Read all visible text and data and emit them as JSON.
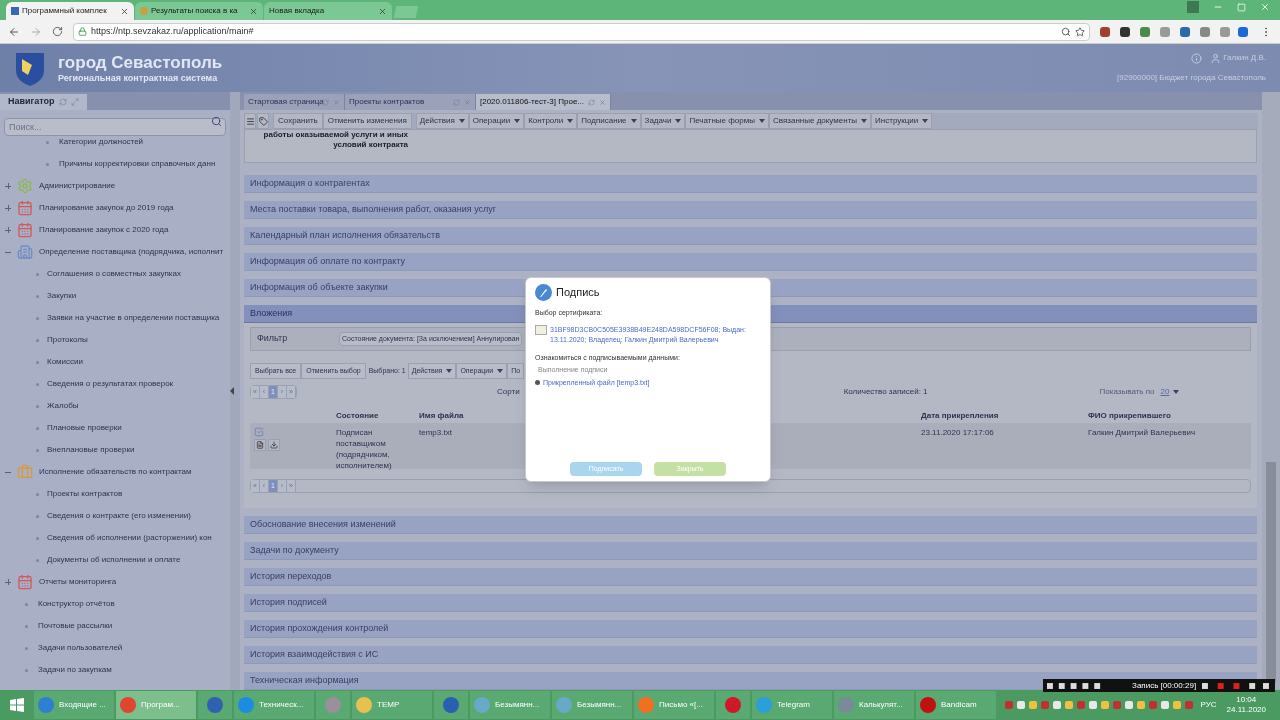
{
  "browser": {
    "tabs": [
      {
        "title": "Программный комплек",
        "selected": true
      },
      {
        "title": "Результаты поиска в ка",
        "selected": false
      },
      {
        "title": "Новая вкладка",
        "selected": false
      }
    ],
    "url": "https://ntp.sevzakaz.ru/application/main#"
  },
  "header": {
    "title": "город Севастополь",
    "subtitle": "Региональная контрактная система",
    "user": "Галкин Д.В.",
    "organization": "[92900000] Бюджет города Севастополь"
  },
  "navigator": {
    "title": "Навигатор",
    "search_placeholder": "Поиск...",
    "items": [
      {
        "kind": "continued",
        "children": [
          {
            "label": "Категории должностей"
          },
          {
            "label": "Причины корректировки справочных данн"
          }
        ]
      },
      {
        "label": "Администрирование",
        "kind": "gear",
        "expanded": false
      },
      {
        "label": "Планирование закупок до 2019 года",
        "kind": "calendar",
        "expanded": false
      },
      {
        "label": "Планирование закупок с 2020 года",
        "kind": "calendar",
        "expanded": false
      },
      {
        "label": "Определение поставщика (подрядчика, исполнит",
        "kind": "building",
        "expanded": true,
        "children": [
          {
            "label": "Соглашения о совместных закупках"
          },
          {
            "label": "Закупки"
          },
          {
            "label": "Заявки на участие в определении поставщика"
          },
          {
            "label": "Протоколы"
          },
          {
            "label": "Комиссии"
          },
          {
            "label": "Сведения о результатах проверок"
          },
          {
            "label": "Жалобы"
          },
          {
            "label": "Плановые проверки"
          },
          {
            "label": "Внеплановые проверки"
          }
        ]
      },
      {
        "label": "Исполнение обязательств по контрактам",
        "kind": "briefcase",
        "expanded": true,
        "children": [
          {
            "label": "Проекты контрактов"
          },
          {
            "label": "Сведения о контракте (его изменении)"
          },
          {
            "label": "Сведения об исполнении (расторжении) кон"
          },
          {
            "label": "Документы об исполнении и оплате"
          }
        ]
      },
      {
        "label": "Отчеты мониторинга",
        "kind": "calendar",
        "expanded": false
      },
      {
        "label": "Конструктор отчётов",
        "kind": "leaf"
      },
      {
        "label": "Почтовые рассылки",
        "kind": "leaf"
      },
      {
        "label": "Задачи пользователей",
        "kind": "leaf"
      },
      {
        "label": "Задачи по закупкам",
        "kind": "leaf"
      }
    ]
  },
  "content_tabs": [
    {
      "label": "Стартовая страница",
      "selected": false
    },
    {
      "label": "Проекты контрактов",
      "selected": false
    },
    {
      "label": "[2020.011806-тест-3] Прое...",
      "selected": true
    }
  ],
  "toolbar": [
    {
      "kind": "menu"
    },
    {
      "kind": "tag"
    },
    {
      "kind": "button",
      "label": "Сохранить"
    },
    {
      "kind": "button",
      "label": "Отменить изменения"
    },
    {
      "kind": "dropdown",
      "label": "Действия"
    },
    {
      "kind": "dropdown",
      "label": "Операции"
    },
    {
      "kind": "dropdown",
      "label": "Контроли"
    },
    {
      "kind": "dropdown",
      "label": "Подписание"
    },
    {
      "kind": "dropdown",
      "label": "Задачи"
    },
    {
      "kind": "dropdown",
      "label": "Печатные формы"
    },
    {
      "kind": "dropdown",
      "label": "Связанные документы"
    },
    {
      "kind": "dropdown",
      "label": "Инструкции"
    }
  ],
  "panel_text": [
    "работы оказываемой услуги и иных",
    "условий контракта"
  ],
  "sections": [
    {
      "title": "Информация о контрагентах",
      "expanded": false
    },
    {
      "title": "Места поставки товара, выполнения работ, оказания услуг",
      "expanded": false
    },
    {
      "title": "Календарный план исполнения обязательств",
      "expanded": false
    },
    {
      "title": "Информация об оплате по контракту",
      "expanded": false
    },
    {
      "title": "Информация об объекте закупки",
      "expanded": false
    },
    {
      "title": "Вложения",
      "expanded": true
    },
    {
      "title": "Обоснование внесения изменений",
      "expanded": false
    },
    {
      "title": "Задачи по документу",
      "expanded": false
    },
    {
      "title": "История переходов",
      "expanded": false
    },
    {
      "title": "История подписей",
      "expanded": false
    },
    {
      "title": "История прохождения контролей",
      "expanded": false
    },
    {
      "title": "История взаимодействия с ИС",
      "expanded": false
    },
    {
      "title": "Техническая информация",
      "expanded": false
    }
  ],
  "attachments": {
    "filter_label": "Фильтр",
    "filter_value": "Состояние документа: [За исключением] Аннулирован",
    "buttons": [
      "Выбрать все",
      "Отменить выбор"
    ],
    "selected_count": "Выбрано: 1",
    "menus": [
      {
        "label": "Действия",
        "dropdown": true
      },
      {
        "label": "Операции",
        "dropdown": true
      },
      {
        "label": "По",
        "dropdown": false
      }
    ],
    "pagers": [
      {
        "items": [
          {
            "label": "«",
            "selected": false
          },
          {
            "label": "‹",
            "selected": false
          },
          {
            "label": "1",
            "selected": true
          },
          {
            "label": "›",
            "selected": false
          },
          {
            "label": "»",
            "selected": false
          }
        ]
      },
      {
        "items": [
          {
            "label": "«",
            "selected": false
          },
          {
            "label": "‹",
            "selected": false
          },
          {
            "label": "1",
            "selected": true
          },
          {
            "label": "›",
            "selected": false
          },
          {
            "label": "»",
            "selected": false
          }
        ]
      }
    ],
    "sort_label": "Сорти",
    "record_count": "Количество записей: 1",
    "page_size_label": "Показывать по",
    "page_size": "20",
    "columns": [
      "Состояние",
      "Имя файла",
      "Дата прикрепления",
      "ФИО прикрепившего"
    ],
    "rows": [
      {
        "checked": true,
        "status": "Подписан поставщиком (подрядчиком, исполнителем)",
        "file": "temp3.txt",
        "date": "23.11.2020 17:17:06",
        "owner": "Галкин Дмитрий Валерьевич"
      }
    ]
  },
  "dialog": {
    "title": "Подпись",
    "cert_label": "Выбор сертификата:",
    "certificate": "31BF98D3CB0C505E3938B49E248DA598DCF56F08; Выдан: 13.11.2020; Владелец: Галкин Дмитрий Валерьевич",
    "data_label": "Ознакомиться с подписываемыми данными:",
    "progress_label": "Выполнение подписи",
    "file_link": "Прикрепленный файл [temp3.txt]",
    "sign_button": "Подписать",
    "close_button": "Закрыть"
  },
  "recorder": "Запись [00:00:29]",
  "taskbar": [
    {
      "label": "Входящие ...",
      "color": "#2f7fd0",
      "selected": false
    },
    {
      "label": "Програм...",
      "color": "#e0452f",
      "selected": true
    },
    {
      "color": "#3060b0",
      "selected": false
    },
    {
      "label": "Техническ...",
      "color": "#1c8ce0",
      "selected": false
    },
    {
      "color": "#9a8f9a",
      "selected": false
    },
    {
      "label": "TEMP",
      "color": "#e6c050",
      "selected": false
    },
    {
      "color": "#2b5fb0",
      "selected": false
    },
    {
      "label": "Безымянн...",
      "color": "#6aa8c8",
      "selected": false
    },
    {
      "label": "Безымянн...",
      "color": "#6aa8c8",
      "selected": false
    },
    {
      "label": "Письмо «[...",
      "color": "#f07020",
      "selected": false
    },
    {
      "color": "#d01828",
      "selected": false
    },
    {
      "label": "Telegram",
      "color": "#2a9fd8",
      "selected": false
    },
    {
      "label": "Калькулят...",
      "color": "#7a8a9a",
      "selected": false
    },
    {
      "label": "Bandicam",
      "color": "#c01010",
      "selected": false
    }
  ],
  "tray": {
    "language": "РУС",
    "time": "10:04",
    "date": "24.11.2020"
  }
}
